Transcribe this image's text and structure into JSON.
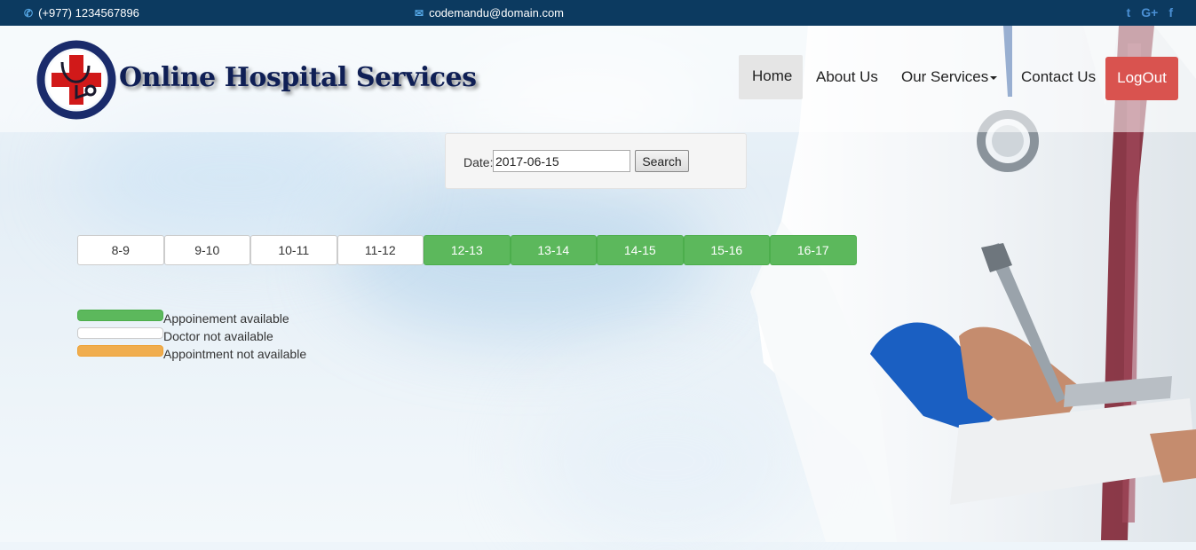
{
  "topbar": {
    "phone": "(+977) 1234567896",
    "email": "codemandu@domain.com",
    "social": [
      "twitter-icon",
      "google-plus-icon",
      "facebook-icon"
    ]
  },
  "header": {
    "brand": "Online Hospital Services",
    "nav": {
      "home": "Home",
      "about": "About Us",
      "services": "Our Services",
      "contact": "Contact Us",
      "logout": "LogOut"
    }
  },
  "search": {
    "label": "Date:",
    "value": "2017-06-15",
    "button": "Search"
  },
  "slots": [
    {
      "label": "8-9",
      "status": "white"
    },
    {
      "label": "9-10",
      "status": "white"
    },
    {
      "label": "10-11",
      "status": "white"
    },
    {
      "label": "11-12",
      "status": "white"
    },
    {
      "label": "12-13",
      "status": "green"
    },
    {
      "label": "13-14",
      "status": "green"
    },
    {
      "label": "14-15",
      "status": "green"
    },
    {
      "label": "15-16",
      "status": "green"
    },
    {
      "label": "16-17",
      "status": "green"
    }
  ],
  "legend": [
    {
      "color": "green",
      "text": "Appoinement available"
    },
    {
      "color": "white",
      "text": "Doctor not available"
    },
    {
      "color": "orange",
      "text": "Appointment not available"
    }
  ],
  "colors": {
    "topbar": "#0c3a60",
    "available": "#5cb85c",
    "not_available": "#f0ad4e",
    "logout": "#d9534f"
  }
}
